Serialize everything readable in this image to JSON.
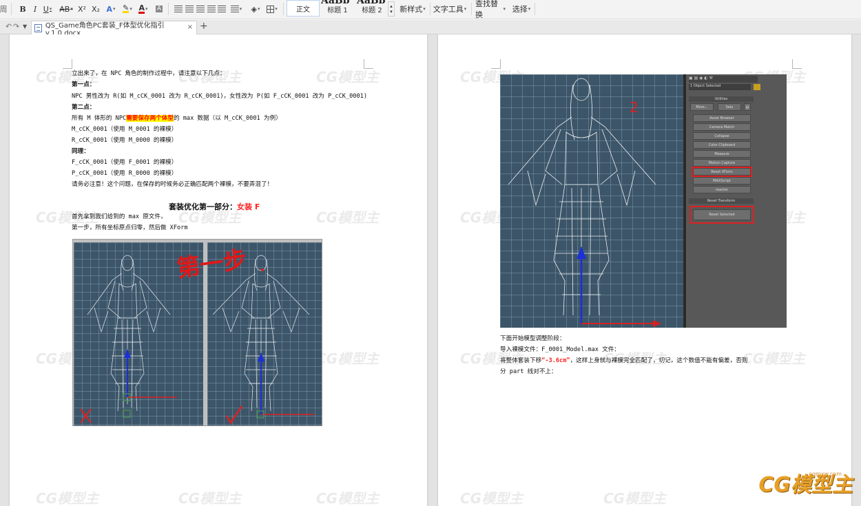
{
  "toolbar": {
    "strike_label": "AB",
    "superscript_label": "X²",
    "subscript_label": "X₂",
    "style_normal": "正文",
    "style_h1": "标题 1",
    "style_h2": "标题 2",
    "style_preview": "AaBb",
    "new_style": "新样式",
    "text_tools": "文字工具",
    "find_replace": "查找替换",
    "select": "选择"
  },
  "tab": {
    "title": "QS_Game角色PC套装_F体型优化指引v.1.0.docx",
    "close": "×",
    "add": "+"
  },
  "left_page": {
    "line1": "立出来了，在 NPC 角色的制作过程中，请注意以下几点：",
    "point1_label": "第一点：",
    "point1_text": "NPC 男性改为 R(如 M_cCK_0001 改为 R_cCK_0001)，女性改为 P(如 F_cCK_0001 改为 P_cCK_0001)",
    "point2_label": "第二点：",
    "point2_pre": "所有 M 体形的 NPC",
    "point2_highlight": "需要保存两个体型",
    "point2_post": "的 max 数据（以 M_cCK_0001 为例）",
    "m_line": "M_cCK_0001（使用 M_0001 的裸模）",
    "r_line": "R_cCK_0001（使用 M_0000 的裸模）",
    "same_label": "同理：",
    "f_line": "F_cCK_0001（使用 F_0001 的裸模）",
    "p_line": "P_cCK_0001（使用 R_0000 的裸模）",
    "notice": "请务必注意！这个问题，在保存的时候务必正确匹配两个裸模，不要弄混了！",
    "heading_main": "套装优化第一部分：",
    "heading_red": "女装 F",
    "intro": "首先拿到我们给到的 max 原文件，",
    "step1": "第一步，所有坐标原点归零，然后做 XForm",
    "handwriting": "第一步"
  },
  "right_page": {
    "number_annotation": "2",
    "line1": "下面开始模型调整阶段：",
    "line2": "导入裸模文件：F_0001_Model.max 文件：",
    "line3_pre": "将整体套装下移",
    "line3_red": "“-3.6cm”",
    "line3_post": "，这样上身就与裸模完全匹配了，切记，这个数值不能有偏差，否则",
    "line4": "分 part 线对不上：",
    "panel": {
      "selection": "1 Object Selected",
      "utilities_header": "Utilities",
      "more": "More...",
      "sets": "Sets",
      "items": [
        "Asset Browser",
        "Camera Match",
        "Collapse",
        "Color Clipboard",
        "Measure",
        "Motion Capture",
        "Reset XForm",
        "MAXScript",
        "reactor"
      ],
      "reset_header": "Reset Transform",
      "reset_selected": "Reset Selected"
    }
  },
  "watermark": {
    "text": "CG模型主",
    "url": "WWW.CGMXW.COM",
    "corner_url": "cgmxw.com"
  },
  "colors": {
    "accent_red": "#ff2020",
    "highlight_yellow": "#ffff00",
    "viewport_bg": "#3d5568",
    "logo_orange": "#e8a028"
  }
}
